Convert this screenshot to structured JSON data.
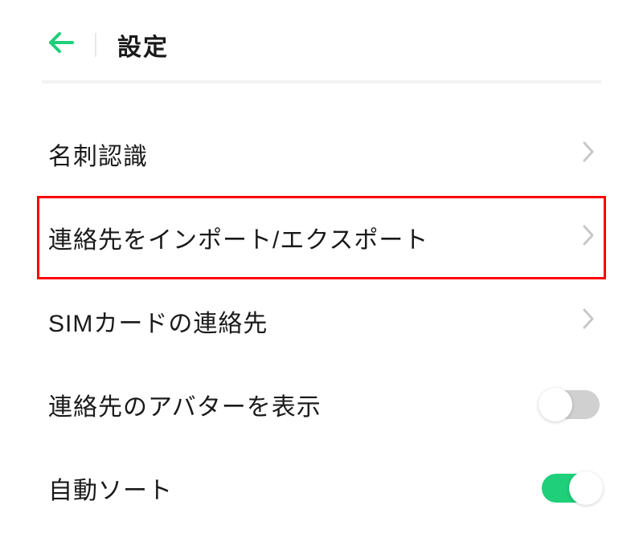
{
  "header": {
    "title": "設定"
  },
  "settings": {
    "items": [
      {
        "label": "名刺認識",
        "type": "nav",
        "highlighted": false
      },
      {
        "label": "連絡先をインポート/エクスポート",
        "type": "nav",
        "highlighted": true
      },
      {
        "label": "SIMカードの連絡先",
        "type": "nav",
        "highlighted": false
      },
      {
        "label": "連絡先のアバターを表示",
        "type": "toggle",
        "value": false
      },
      {
        "label": "自動ソート",
        "type": "toggle",
        "value": true
      }
    ]
  },
  "colors": {
    "accent": "#1fcf7a",
    "highlight_border": "#ff0000"
  }
}
